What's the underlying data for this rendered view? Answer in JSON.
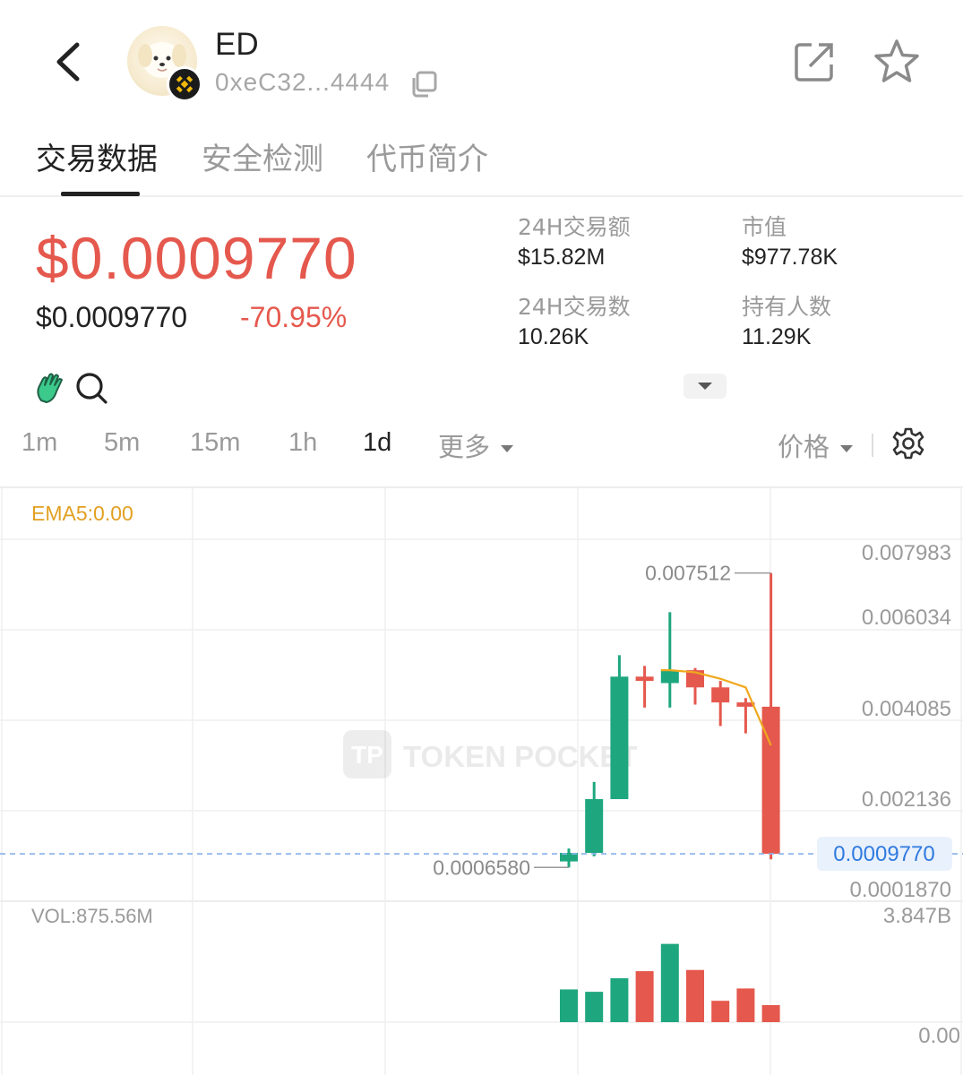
{
  "header": {
    "token_name": "ED",
    "token_address": "0xeC32...4444"
  },
  "tabs": [
    {
      "label": "交易数据",
      "active": true
    },
    {
      "label": "安全检测",
      "active": false
    },
    {
      "label": "代币简介",
      "active": false
    }
  ],
  "price": {
    "main": "$0.0009770",
    "secondary": "$0.0009770",
    "change": "-70.95%"
  },
  "stats": {
    "volume_24h_label": "24H交易额",
    "volume_24h_value": "$15.82M",
    "market_cap_label": "市值",
    "market_cap_value": "$977.78K",
    "trades_24h_label": "24H交易数",
    "trades_24h_value": "10.26K",
    "holders_label": "持有人数",
    "holders_value": "11.29K"
  },
  "intervals": [
    {
      "label": "1m",
      "active": false
    },
    {
      "label": "5m",
      "active": false
    },
    {
      "label": "15m",
      "active": false
    },
    {
      "label": "1h",
      "active": false
    },
    {
      "label": "1d",
      "active": true
    }
  ],
  "more_label": "更多",
  "price_mode_label": "价格",
  "chart_data": {
    "type": "candlestick",
    "indicator_label": "EMA5:0.00",
    "volume_label": "VOL:875.56M",
    "watermark": "TOKEN POCKET",
    "price_ticks": [
      "0.007983",
      "0.006034",
      "0.004085",
      "0.002136",
      "0.0001870"
    ],
    "volume_ticks": [
      "3.847B",
      "0.00"
    ],
    "max_label": "0.007512",
    "min_label": "0.0006580",
    "current_price_label": "0.0009770",
    "current_price": 0.000977,
    "ylim": [
      0.000187,
      0.007983
    ],
    "colors": {
      "up": "#1ea77f",
      "down": "#e5584d",
      "ema": "#f0a81d",
      "current_line": "#8fb5ea"
    },
    "candles": [
      {
        "open": 0.0008,
        "high": 0.0011,
        "low": 0.00066,
        "close": 0.001
      },
      {
        "open": 0.001,
        "high": 0.00265,
        "low": 0.00092,
        "close": 0.00225
      },
      {
        "open": 0.00225,
        "high": 0.0056,
        "low": 0.00225,
        "close": 0.0051
      },
      {
        "open": 0.0051,
        "high": 0.00535,
        "low": 0.00438,
        "close": 0.005
      },
      {
        "open": 0.00495,
        "high": 0.0066,
        "low": 0.00438,
        "close": 0.00525
      },
      {
        "open": 0.00525,
        "high": 0.0053,
        "low": 0.00445,
        "close": 0.00485
      },
      {
        "open": 0.00485,
        "high": 0.005,
        "low": 0.00395,
        "close": 0.0045
      },
      {
        "open": 0.0045,
        "high": 0.0046,
        "low": 0.00378,
        "close": 0.0044
      },
      {
        "open": 0.0044,
        "high": 0.007512,
        "low": 0.00085,
        "close": 0.000977
      }
    ],
    "volumes": [
      {
        "value": 1.38,
        "direction": "up"
      },
      {
        "value": 1.28,
        "direction": "up"
      },
      {
        "value": 1.85,
        "direction": "up"
      },
      {
        "value": 2.15,
        "direction": "down"
      },
      {
        "value": 3.3,
        "direction": "up"
      },
      {
        "value": 2.2,
        "direction": "down"
      },
      {
        "value": 0.9,
        "direction": "down"
      },
      {
        "value": 1.42,
        "direction": "down"
      },
      {
        "value": 0.72,
        "direction": "down"
      }
    ],
    "volume_ylim": [
      0,
      3.847
    ],
    "ema": [
      null,
      null,
      null,
      null,
      0.00525,
      0.0052,
      0.00505,
      0.00485,
      0.0035
    ]
  }
}
